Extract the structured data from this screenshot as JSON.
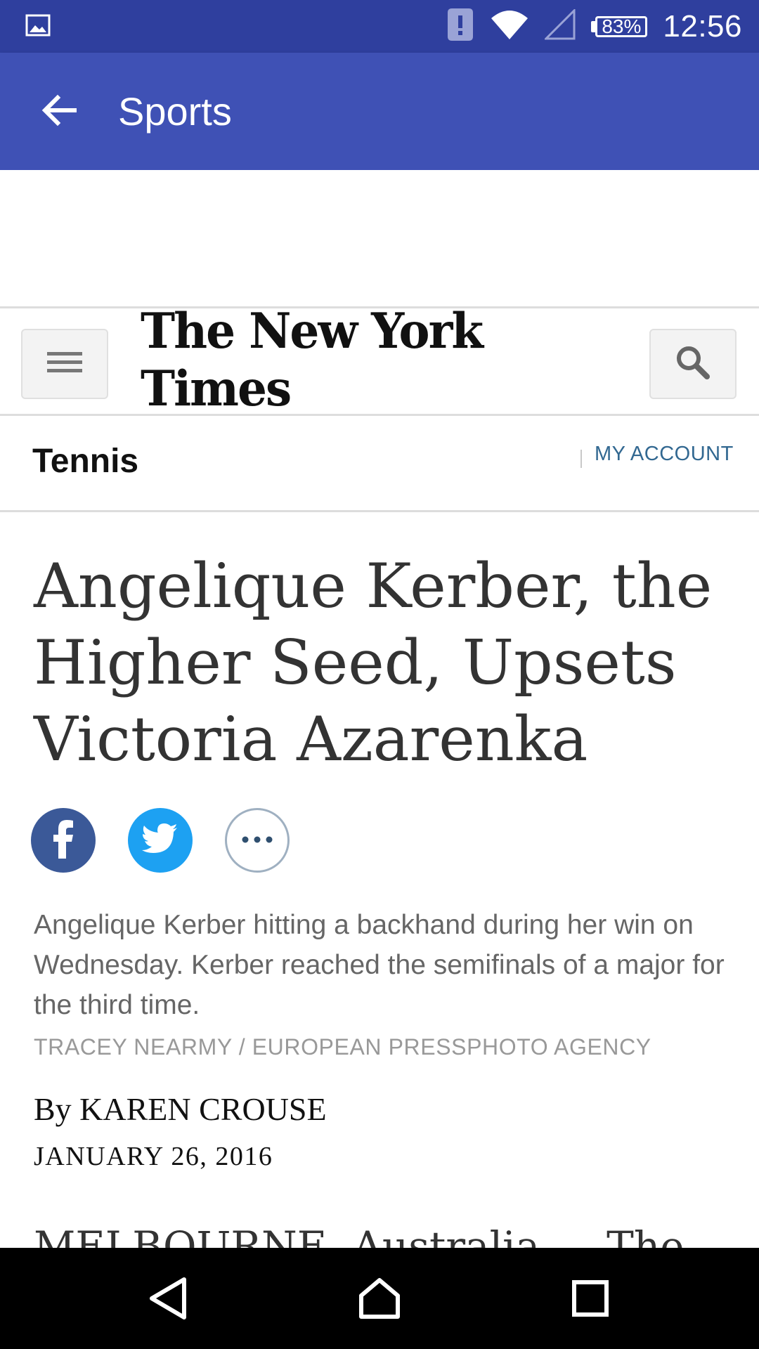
{
  "status_bar": {
    "battery": "83%",
    "time": "12:56",
    "icons": [
      "image-notification-icon",
      "alert-icon",
      "wifi-icon",
      "signal-icon",
      "battery-icon"
    ]
  },
  "app_bar": {
    "title": "Sports",
    "back_icon": "arrow-back-icon"
  },
  "nyt": {
    "logo": "The New York Times",
    "menu_icon": "hamburger-menu-icon",
    "search_icon": "search-icon"
  },
  "section": {
    "name": "Tennis",
    "account_link": "MY ACCOUNT"
  },
  "article": {
    "headline": "Angelique Kerber, the Higher Seed, Upsets Victoria Azarenka",
    "share": [
      "facebook-icon",
      "twitter-icon",
      "more-icon"
    ],
    "caption": "Angelique Kerber hitting a backhand during her win on Wednesday. Kerber reached the semifinals of a major for the third time.",
    "photo_credit": "TRACEY NEARMY / EUROPEAN PRESSPHOTO AGENCY",
    "byline": "By KAREN CROUSE",
    "date": "JANUARY 26, 2016",
    "body_start": "MELBOURNE, Australia — The"
  },
  "nav_bar": {
    "icons": [
      "back-triangle-icon",
      "home-icon",
      "recents-icon"
    ]
  },
  "colors": {
    "status_bar": "#2f3f9e",
    "app_bar": "#3f51b5",
    "link": "#326891",
    "facebook": "#3b5998",
    "twitter": "#1da1f2"
  }
}
